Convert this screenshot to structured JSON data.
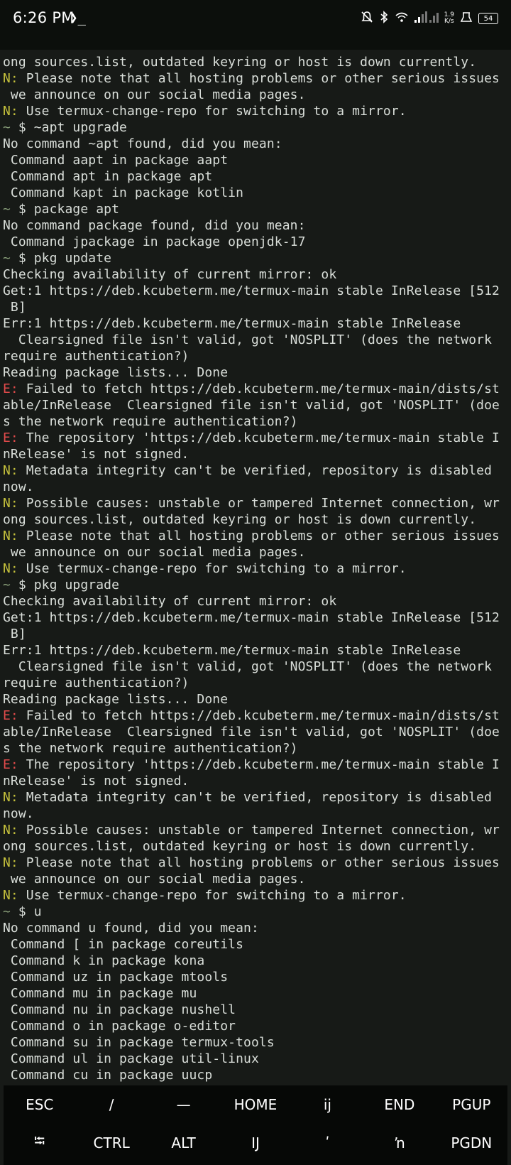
{
  "status_bar": {
    "time": "6:26 PM",
    "prompt_icon": "❯_",
    "net_speed_value": "1.9",
    "net_speed_unit": "K/s",
    "battery": "54",
    "icons": [
      "mute-icon",
      "bluetooth-icon",
      "wifi-icon",
      "signal-icon",
      "alarm-icon",
      "battery-icon"
    ]
  },
  "terminal": {
    "lines": [
      {
        "tag": "",
        "tag_type": "",
        "text": "ong sources.list, outdated keyring or host is down currently."
      },
      {
        "tag": "N:",
        "tag_type": "note",
        "text": " Please note that all hosting problems or other serious issues"
      },
      {
        "tag": "",
        "tag_type": "",
        "text": " we announce on our social media pages."
      },
      {
        "tag": "N:",
        "tag_type": "note",
        "text": " Use termux-change-repo for switching to a mirror."
      },
      {
        "tag": "~",
        "tag_type": "prompt",
        "text": " $ ~apt upgrade"
      },
      {
        "tag": "",
        "tag_type": "",
        "text": "No command ~apt found, did you mean:"
      },
      {
        "tag": "",
        "tag_type": "",
        "text": " Command aapt in package aapt"
      },
      {
        "tag": "",
        "tag_type": "",
        "text": " Command apt in package apt"
      },
      {
        "tag": "",
        "tag_type": "",
        "text": " Command kapt in package kotlin"
      },
      {
        "tag": "~",
        "tag_type": "prompt",
        "text": " $ package apt"
      },
      {
        "tag": "",
        "tag_type": "",
        "text": "No command package found, did you mean:"
      },
      {
        "tag": "",
        "tag_type": "",
        "text": " Command jpackage in package openjdk-17"
      },
      {
        "tag": "~",
        "tag_type": "prompt",
        "text": " $ pkg update"
      },
      {
        "tag": "",
        "tag_type": "",
        "text": "Checking availability of current mirror: ok"
      },
      {
        "tag": "",
        "tag_type": "",
        "text": "Get:1 https://deb.kcubeterm.me/termux-main stable InRelease [512"
      },
      {
        "tag": "",
        "tag_type": "",
        "text": " B]"
      },
      {
        "tag": "",
        "tag_type": "",
        "text": "Err:1 https://deb.kcubeterm.me/termux-main stable InRelease"
      },
      {
        "tag": "",
        "tag_type": "",
        "text": "  Clearsigned file isn't valid, got 'NOSPLIT' (does the network"
      },
      {
        "tag": "",
        "tag_type": "",
        "text": "require authentication?)"
      },
      {
        "tag": "",
        "tag_type": "",
        "text": "Reading package lists... Done"
      },
      {
        "tag": "E:",
        "tag_type": "error",
        "text": " Failed to fetch https://deb.kcubeterm.me/termux-main/dists/st"
      },
      {
        "tag": "",
        "tag_type": "",
        "text": "able/InRelease  Clearsigned file isn't valid, got 'NOSPLIT' (doe"
      },
      {
        "tag": "",
        "tag_type": "",
        "text": "s the network require authentication?)"
      },
      {
        "tag": "E:",
        "tag_type": "error",
        "text": " The repository 'https://deb.kcubeterm.me/termux-main stable I"
      },
      {
        "tag": "",
        "tag_type": "",
        "text": "nRelease' is not signed."
      },
      {
        "tag": "N:",
        "tag_type": "note",
        "text": " Metadata integrity can't be verified, repository is disabled"
      },
      {
        "tag": "",
        "tag_type": "",
        "text": "now."
      },
      {
        "tag": "N:",
        "tag_type": "note",
        "text": " Possible causes: unstable or tampered Internet connection, wr"
      },
      {
        "tag": "",
        "tag_type": "",
        "text": "ong sources.list, outdated keyring or host is down currently."
      },
      {
        "tag": "N:",
        "tag_type": "note",
        "text": " Please note that all hosting problems or other serious issues"
      },
      {
        "tag": "",
        "tag_type": "",
        "text": " we announce on our social media pages."
      },
      {
        "tag": "N:",
        "tag_type": "note",
        "text": " Use termux-change-repo for switching to a mirror."
      },
      {
        "tag": "~",
        "tag_type": "prompt",
        "text": " $ pkg upgrade"
      },
      {
        "tag": "",
        "tag_type": "",
        "text": "Checking availability of current mirror: ok"
      },
      {
        "tag": "",
        "tag_type": "",
        "text": "Get:1 https://deb.kcubeterm.me/termux-main stable InRelease [512"
      },
      {
        "tag": "",
        "tag_type": "",
        "text": " B]"
      },
      {
        "tag": "",
        "tag_type": "",
        "text": "Err:1 https://deb.kcubeterm.me/termux-main stable InRelease"
      },
      {
        "tag": "",
        "tag_type": "",
        "text": "  Clearsigned file isn't valid, got 'NOSPLIT' (does the network"
      },
      {
        "tag": "",
        "tag_type": "",
        "text": "require authentication?)"
      },
      {
        "tag": "",
        "tag_type": "",
        "text": "Reading package lists... Done"
      },
      {
        "tag": "E:",
        "tag_type": "error",
        "text": " Failed to fetch https://deb.kcubeterm.me/termux-main/dists/st"
      },
      {
        "tag": "",
        "tag_type": "",
        "text": "able/InRelease  Clearsigned file isn't valid, got 'NOSPLIT' (doe"
      },
      {
        "tag": "",
        "tag_type": "",
        "text": "s the network require authentication?)"
      },
      {
        "tag": "E:",
        "tag_type": "error",
        "text": " The repository 'https://deb.kcubeterm.me/termux-main stable I"
      },
      {
        "tag": "",
        "tag_type": "",
        "text": "nRelease' is not signed."
      },
      {
        "tag": "N:",
        "tag_type": "note",
        "text": " Metadata integrity can't be verified, repository is disabled"
      },
      {
        "tag": "",
        "tag_type": "",
        "text": "now."
      },
      {
        "tag": "N:",
        "tag_type": "note",
        "text": " Possible causes: unstable or tampered Internet connection, wr"
      },
      {
        "tag": "",
        "tag_type": "",
        "text": "ong sources.list, outdated keyring or host is down currently."
      },
      {
        "tag": "N:",
        "tag_type": "note",
        "text": " Please note that all hosting problems or other serious issues"
      },
      {
        "tag": "",
        "tag_type": "",
        "text": " we announce on our social media pages."
      },
      {
        "tag": "N:",
        "tag_type": "note",
        "text": " Use termux-change-repo for switching to a mirror."
      },
      {
        "tag": "~",
        "tag_type": "prompt",
        "text": " $ u"
      },
      {
        "tag": "",
        "tag_type": "",
        "text": "No command u found, did you mean:"
      },
      {
        "tag": "",
        "tag_type": "",
        "text": " Command [ in package coreutils"
      },
      {
        "tag": "",
        "tag_type": "",
        "text": " Command k in package kona"
      },
      {
        "tag": "",
        "tag_type": "",
        "text": " Command uz in package mtools"
      },
      {
        "tag": "",
        "tag_type": "",
        "text": " Command mu in package mu"
      },
      {
        "tag": "",
        "tag_type": "",
        "text": " Command nu in package nushell"
      },
      {
        "tag": "",
        "tag_type": "",
        "text": " Command o in package o-editor"
      },
      {
        "tag": "",
        "tag_type": "",
        "text": " Command su in package termux-tools"
      },
      {
        "tag": "",
        "tag_type": "",
        "text": " Command ul in package util-linux"
      },
      {
        "tag": "",
        "tag_type": "",
        "text": " Command cu in package uucp"
      }
    ]
  },
  "extra_keys": {
    "row1": [
      "ESC",
      "/",
      "—",
      "HOME",
      "ĳ",
      "END",
      "PGUP"
    ],
    "row2": [
      "⭾",
      "CTRL",
      "ALT",
      "Ĳ",
      "ʹ",
      "ŉ",
      "PGDN"
    ]
  },
  "colors": {
    "background": "#171a17",
    "text": "#d9ded9",
    "note_tag": "#c5c13c",
    "error_tag": "#e24b4b",
    "prompt_tag": "#8aa07a"
  }
}
